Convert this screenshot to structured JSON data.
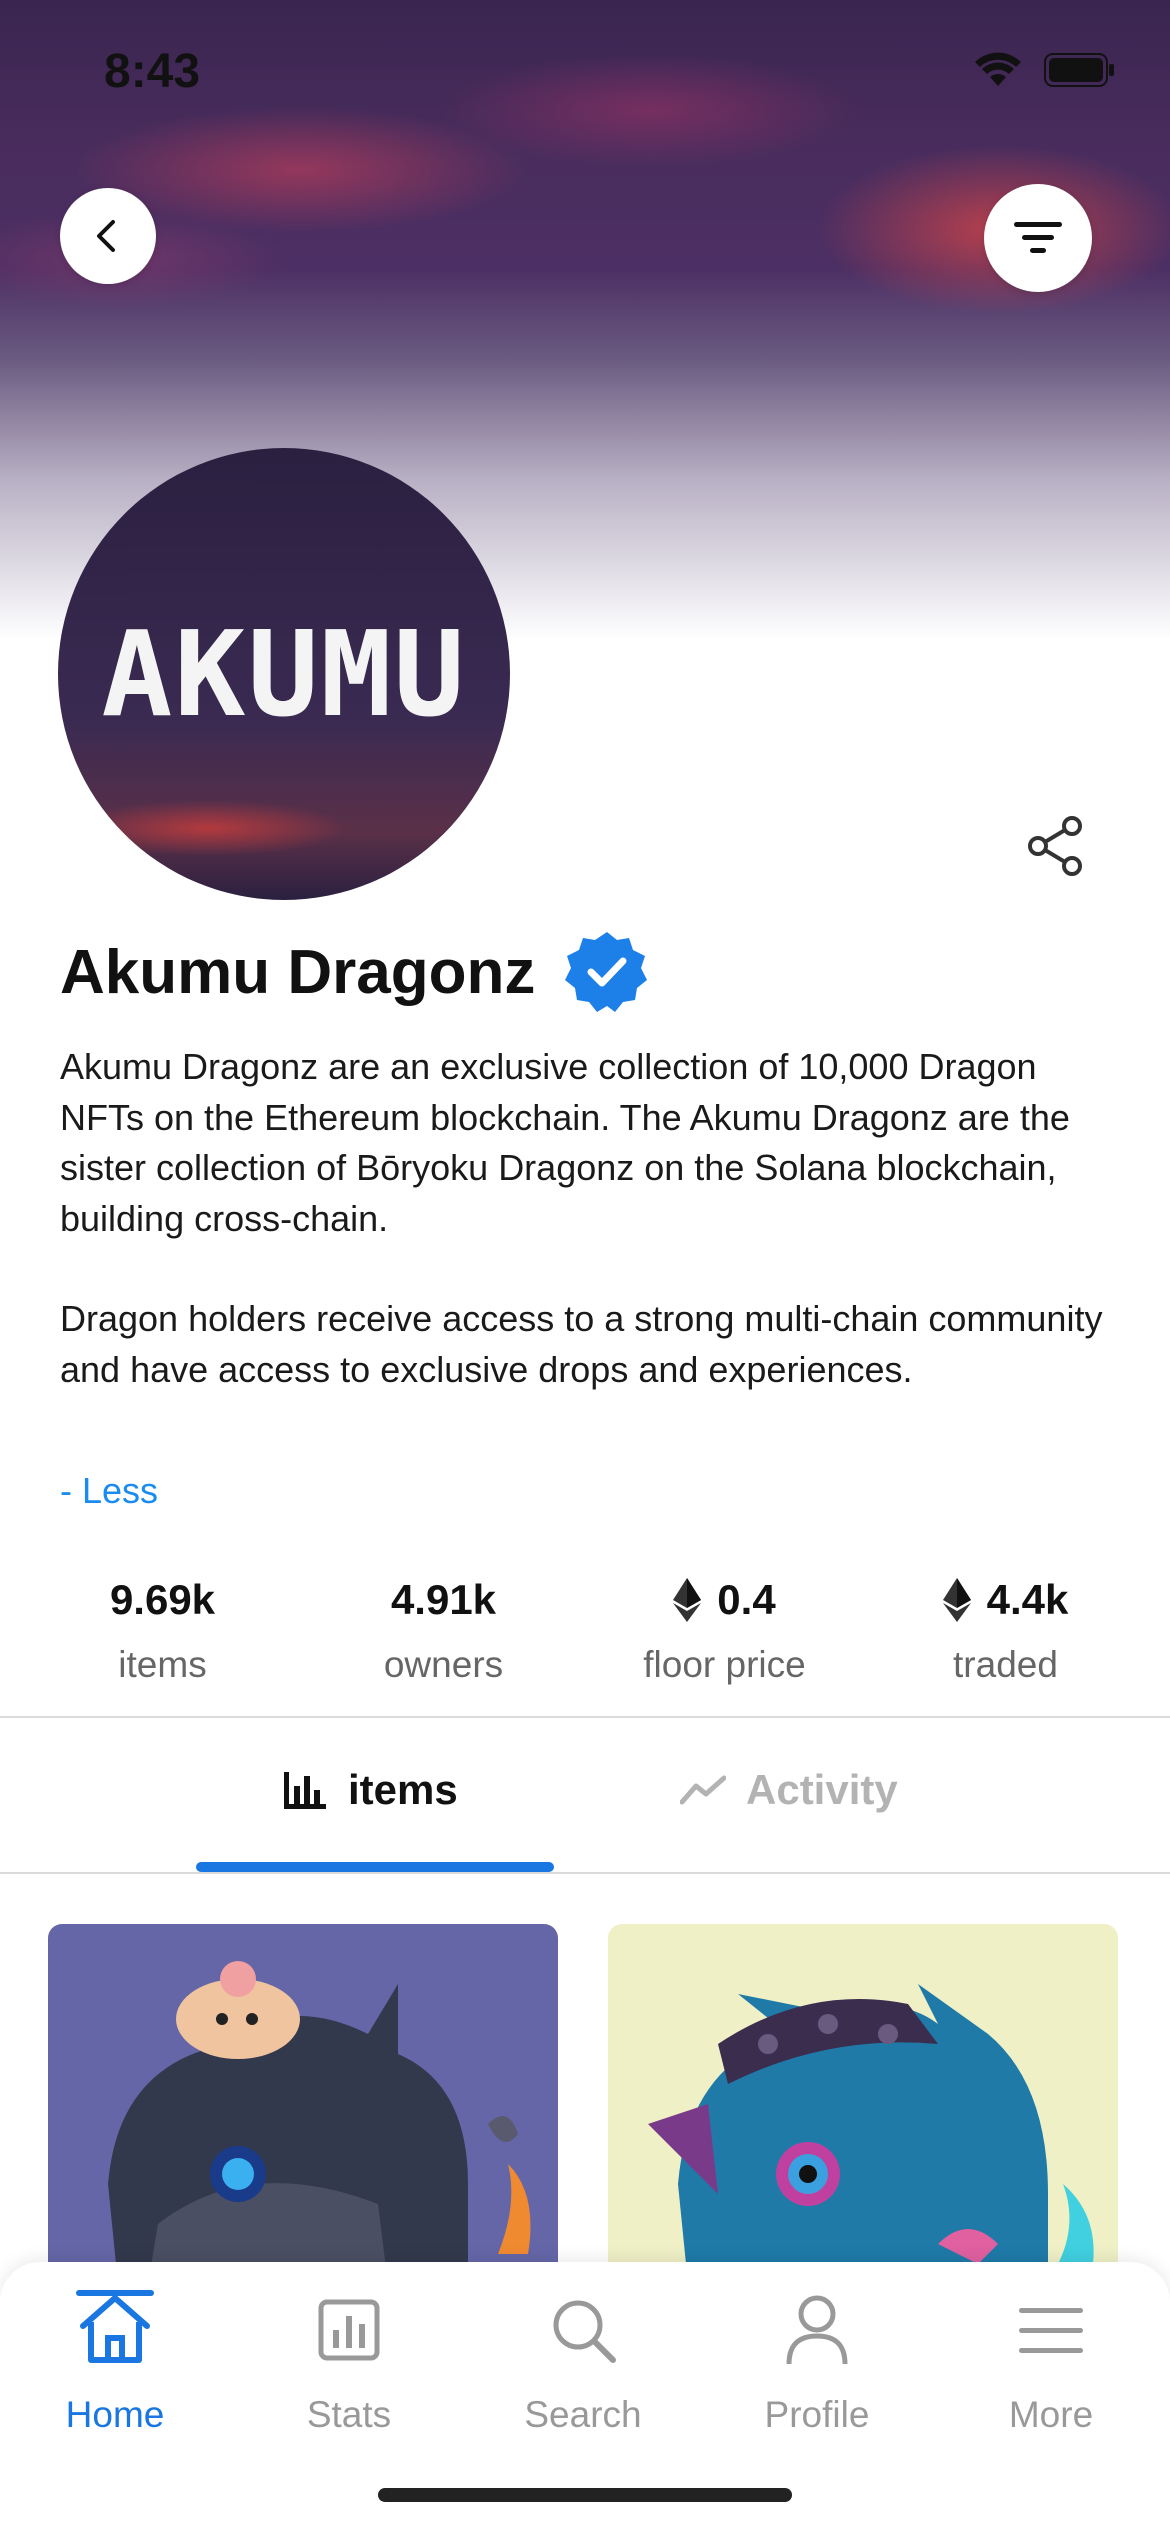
{
  "status_bar": {
    "time": "8:43"
  },
  "header": {
    "back_icon": "chevron-left-icon",
    "filter_icon": "filter-icon"
  },
  "collection": {
    "avatar_text": "AKUMU",
    "name": "Akumu Dragonz",
    "verified_icon": "verified-badge-icon",
    "share_icon": "share-icon",
    "description": [
      "Akumu Dragonz are an exclusive collection of 10,000 Dragon NFTs on the Ethereum blockchain. The Akumu Dragonz are the sister collection of Bōryoku Dragonz on the Solana blockchain, building cross-chain.",
      "Dragon holders receive access to a strong multi-chain community and have access to exclusive drops and experiences."
    ],
    "toggle_label": "- Less"
  },
  "stats": [
    {
      "value": "9.69k",
      "label": "items",
      "icon": ""
    },
    {
      "value": "4.91k",
      "label": "owners",
      "icon": ""
    },
    {
      "value": "0.4",
      "label": "floor price",
      "icon": "ethereum-icon"
    },
    {
      "value": "4.4k",
      "label": "traded",
      "icon": "ethereum-icon"
    }
  ],
  "tabs": [
    {
      "label": "items",
      "icon": "bar-chart-icon",
      "active": true
    },
    {
      "label": "Activity",
      "icon": "trend-line-icon",
      "active": false
    }
  ],
  "nav": [
    {
      "label": "Home",
      "icon": "home-icon",
      "active": true
    },
    {
      "label": "Stats",
      "icon": "stats-icon",
      "active": false
    },
    {
      "label": "Search",
      "icon": "search-icon",
      "active": false
    },
    {
      "label": "Profile",
      "icon": "profile-icon",
      "active": false
    },
    {
      "label": "More",
      "icon": "menu-icon",
      "active": false
    }
  ],
  "colors": {
    "accent": "#1a76e0",
    "link": "#1a8cf0",
    "verified": "#1d7fe8",
    "card1_bg": "#6566a8",
    "card2_bg": "#eff0c6"
  }
}
